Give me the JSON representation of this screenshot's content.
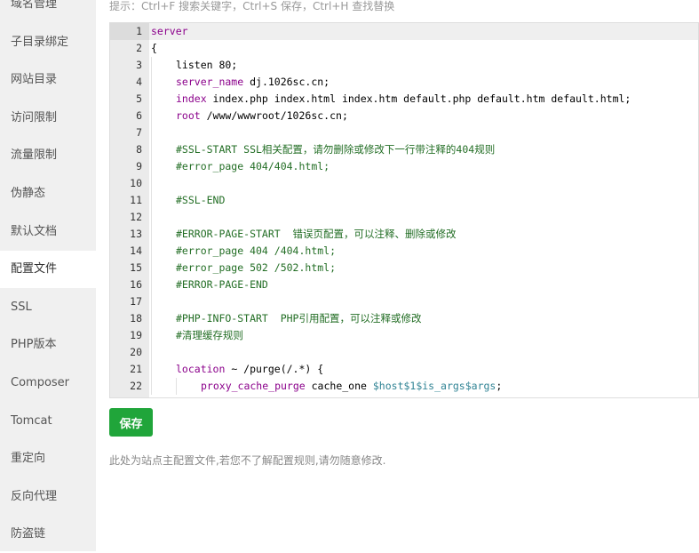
{
  "sidebar": {
    "items": [
      {
        "label": "域名管理",
        "active": false
      },
      {
        "label": "子目录绑定",
        "active": false
      },
      {
        "label": "网站目录",
        "active": false
      },
      {
        "label": "访问限制",
        "active": false
      },
      {
        "label": "流量限制",
        "active": false
      },
      {
        "label": "伪静态",
        "active": false
      },
      {
        "label": "默认文档",
        "active": false
      },
      {
        "label": "配置文件",
        "active": true
      },
      {
        "label": "SSL",
        "active": false
      },
      {
        "label": "PHP版本",
        "active": false
      },
      {
        "label": "Composer",
        "active": false
      },
      {
        "label": "Tomcat",
        "active": false
      },
      {
        "label": "重定向",
        "active": false
      },
      {
        "label": "反向代理",
        "active": false
      },
      {
        "label": "防盗链",
        "active": false
      }
    ]
  },
  "tip": "提示：Ctrl+F 搜索关键字，Ctrl+S 保存，Ctrl+H 查找替换",
  "editor": {
    "current_line": 1,
    "lines": [
      {
        "n": "1",
        "indent": 0,
        "tokens": [
          {
            "t": "server",
            "c": "k"
          }
        ]
      },
      {
        "n": "2",
        "indent": 0,
        "tokens": [
          {
            "t": "{",
            "c": ""
          }
        ]
      },
      {
        "n": "3",
        "indent": 1,
        "tokens": [
          {
            "t": "listen 80;",
            "c": ""
          }
        ]
      },
      {
        "n": "4",
        "indent": 1,
        "tokens": [
          {
            "t": "server_name",
            "c": "kw"
          },
          {
            "t": " dj.1026sc.cn;",
            "c": ""
          }
        ]
      },
      {
        "n": "5",
        "indent": 1,
        "tokens": [
          {
            "t": "index",
            "c": "kw"
          },
          {
            "t": " index.php index.html index.htm default.php default.htm default.html;",
            "c": ""
          }
        ]
      },
      {
        "n": "6",
        "indent": 1,
        "tokens": [
          {
            "t": "root",
            "c": "kw"
          },
          {
            "t": " /www/wwwroot/1026sc.cn;",
            "c": ""
          }
        ]
      },
      {
        "n": "7",
        "indent": 1,
        "tokens": []
      },
      {
        "n": "8",
        "indent": 1,
        "tokens": [
          {
            "t": "#SSL-START SSL相关配置，请勿删除或修改下一行带注释的404规则",
            "c": "c"
          }
        ]
      },
      {
        "n": "9",
        "indent": 1,
        "tokens": [
          {
            "t": "#error_page 404/404.html;",
            "c": "c"
          }
        ]
      },
      {
        "n": "10",
        "indent": 1,
        "tokens": []
      },
      {
        "n": "11",
        "indent": 1,
        "tokens": [
          {
            "t": "#SSL-END",
            "c": "c"
          }
        ]
      },
      {
        "n": "12",
        "indent": 1,
        "tokens": []
      },
      {
        "n": "13",
        "indent": 1,
        "tokens": [
          {
            "t": "#ERROR-PAGE-START  错误页配置，可以注释、删除或修改",
            "c": "c"
          }
        ]
      },
      {
        "n": "14",
        "indent": 1,
        "tokens": [
          {
            "t": "#error_page 404 /404.html;",
            "c": "c"
          }
        ]
      },
      {
        "n": "15",
        "indent": 1,
        "tokens": [
          {
            "t": "#error_page 502 /502.html;",
            "c": "c"
          }
        ]
      },
      {
        "n": "16",
        "indent": 1,
        "tokens": [
          {
            "t": "#ERROR-PAGE-END",
            "c": "c"
          }
        ]
      },
      {
        "n": "17",
        "indent": 1,
        "tokens": []
      },
      {
        "n": "18",
        "indent": 1,
        "tokens": [
          {
            "t": "#PHP-INFO-START  PHP引用配置，可以注释或修改",
            "c": "c"
          }
        ]
      },
      {
        "n": "19",
        "indent": 1,
        "tokens": [
          {
            "t": "#清理缓存规则",
            "c": "c"
          }
        ]
      },
      {
        "n": "20",
        "indent": 1,
        "tokens": []
      },
      {
        "n": "21",
        "indent": 1,
        "tokens": [
          {
            "t": "location",
            "c": "kw"
          },
          {
            "t": " ~ /purge(/.*) {",
            "c": ""
          }
        ]
      },
      {
        "n": "22",
        "indent": 2,
        "tokens": [
          {
            "t": "proxy_cache_purge",
            "c": "kw"
          },
          {
            "t": " cache_one ",
            "c": ""
          },
          {
            "t": "$host$1$is_args$args",
            "c": "v"
          },
          {
            "t": ";",
            "c": ""
          }
        ]
      }
    ]
  },
  "save_label": "保存",
  "note": "此处为站点主配置文件,若您不了解配置规则,请勿随意修改."
}
